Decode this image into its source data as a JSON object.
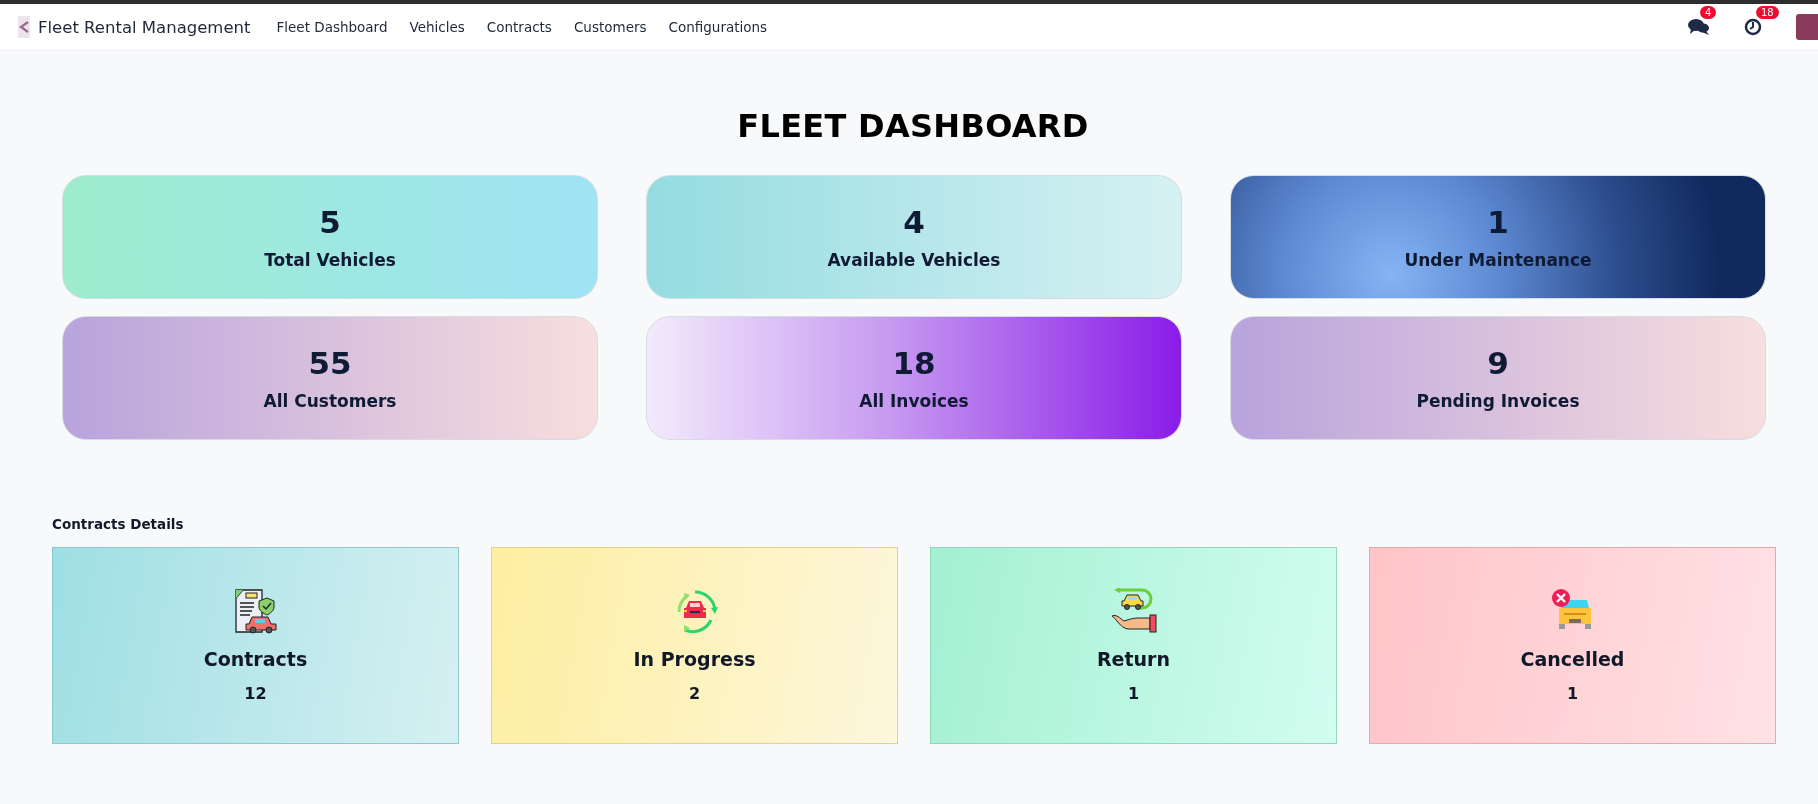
{
  "navbar": {
    "app_name": "Fleet Rental Management",
    "menu": [
      "Fleet Dashboard",
      "Vehicles",
      "Contracts",
      "Customers",
      "Configurations"
    ],
    "messages_badge": "4",
    "activities_badge": "18"
  },
  "title": "FLEET DASHBOARD",
  "stats": [
    {
      "value": "5",
      "label": "Total Vehicles"
    },
    {
      "value": "4",
      "label": "Available Vehicles"
    },
    {
      "value": "1",
      "label": "Under Maintenance"
    },
    {
      "value": "55",
      "label": "All Customers"
    },
    {
      "value": "18",
      "label": "All Invoices"
    },
    {
      "value": "9",
      "label": "Pending Invoices"
    }
  ],
  "contracts_details": {
    "heading": "Contracts Details",
    "cards": [
      {
        "kind": "contract",
        "label": "Contracts",
        "count": "12"
      },
      {
        "kind": "progress",
        "label": "In Progress",
        "count": "2"
      },
      {
        "kind": "return",
        "label": "Return",
        "count": "1"
      },
      {
        "kind": "cancelled",
        "label": "Cancelled",
        "count": "1"
      }
    ]
  }
}
